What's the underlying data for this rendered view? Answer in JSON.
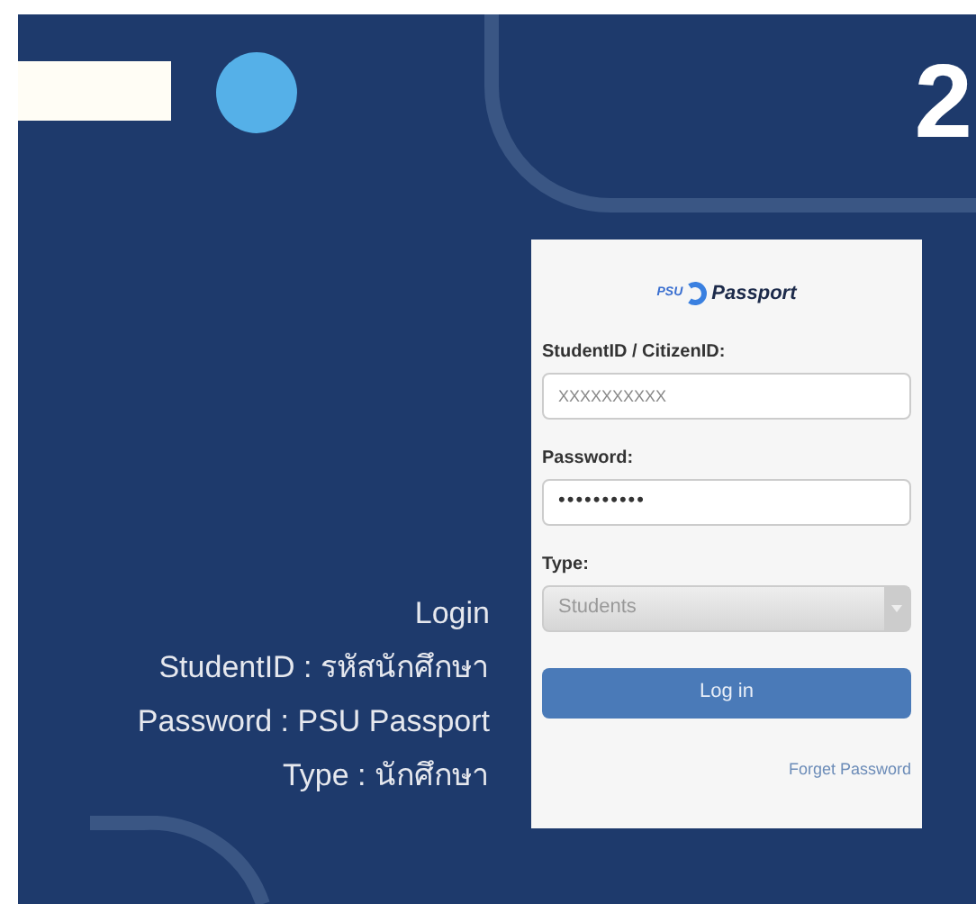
{
  "slide_number": "2",
  "instructions": [
    "Login",
    "StudentID : รหัสนักศึกษา",
    "Password : PSU Passport",
    "Type : นักศึกษา"
  ],
  "login_form": {
    "logo": {
      "prefix": "PSU",
      "name": "Passport"
    },
    "fields": [
      {
        "kind": "text",
        "label": "StudentID / CitizenID:",
        "placeholder": "XXXXXXXXXX"
      },
      {
        "kind": "password",
        "label": "Password:",
        "value": "••••••••••"
      },
      {
        "kind": "select",
        "label": "Type:",
        "value": "Students",
        "disabled": true
      }
    ],
    "submit": "Log in",
    "link": "Forget Password"
  }
}
